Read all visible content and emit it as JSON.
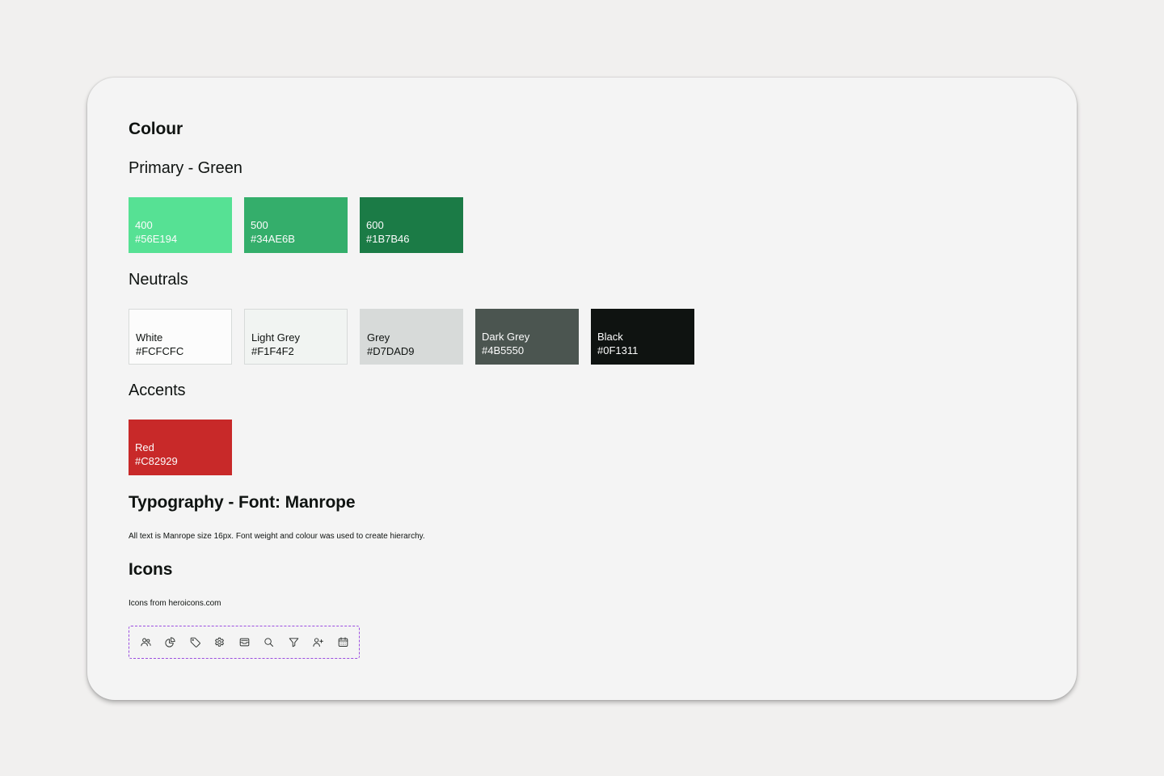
{
  "headings": {
    "colour": "Colour",
    "primary": "Primary - Green",
    "neutrals": "Neutrals",
    "accents": "Accents",
    "typography": "Typography - Font: Manrope",
    "icons": "Icons"
  },
  "primary": [
    {
      "name": "400",
      "hex": "#56E194",
      "color": "#56E194"
    },
    {
      "name": "500",
      "hex": "#34AE6B",
      "color": "#34AE6B"
    },
    {
      "name": "600",
      "hex": "#1B7B46",
      "color": "#1B7B46"
    }
  ],
  "neutrals": [
    {
      "name": "White",
      "hex": "#FCFCFC",
      "color": "#FCFCFC"
    },
    {
      "name": "Light Grey",
      "hex": "#F1F4F2",
      "color": "#F1F4F2"
    },
    {
      "name": "Grey",
      "hex": "#D7DAD9",
      "color": "#D7DAD9"
    },
    {
      "name": "Dark Grey",
      "hex": "#4B5550",
      "color": "#4B5550"
    },
    {
      "name": "Black",
      "hex": "#0F1311",
      "color": "#0F1311"
    }
  ],
  "accents": [
    {
      "name": "Red",
      "hex": "#C82929",
      "color": "#C82929"
    }
  ],
  "typography": {
    "description": "All text is Manrope size 16px. Font weight and colour was used to create hierarchy."
  },
  "icons": {
    "source": "Icons from heroicons.com",
    "items": [
      "users-icon",
      "chart-pie-icon",
      "tag-icon",
      "cog-icon",
      "inbox-icon",
      "search-icon",
      "filter-icon",
      "user-add-icon",
      "calendar-icon"
    ],
    "border_color": "#9B4DE0"
  }
}
